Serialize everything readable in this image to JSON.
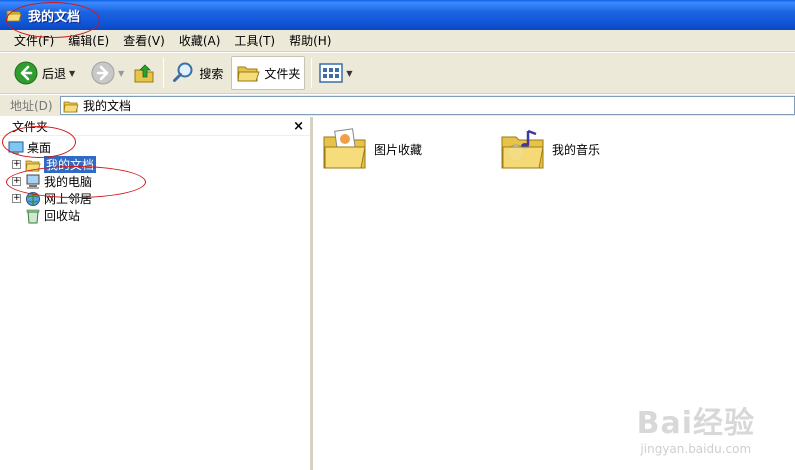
{
  "window": {
    "title": "我的文档"
  },
  "menu": [
    "文件(F)",
    "编辑(E)",
    "查看(V)",
    "收藏(A)",
    "工具(T)",
    "帮助(H)"
  ],
  "toolbar": {
    "back": "后退",
    "search": "搜索",
    "folders": "文件夹"
  },
  "address": {
    "label": "地址(D)",
    "value": "我的文档"
  },
  "folder_pane": {
    "title": "文件夹",
    "close": "×",
    "tree": {
      "desktop": "桌面",
      "my_documents": "我的文档",
      "my_computer": "我的电脑",
      "network": "网上邻居",
      "recycle_bin": "回收站",
      "expander": "+"
    }
  },
  "content": {
    "items": [
      "图片收藏",
      "我的音乐"
    ]
  },
  "watermark": {
    "brand": "Bai经验",
    "url": "jingyan.baidu.com"
  },
  "colors": {
    "title_blue": "#0f54d6",
    "chrome": "#ece9d8",
    "selection": "#316ac5",
    "annotation_red": "#d01818"
  }
}
